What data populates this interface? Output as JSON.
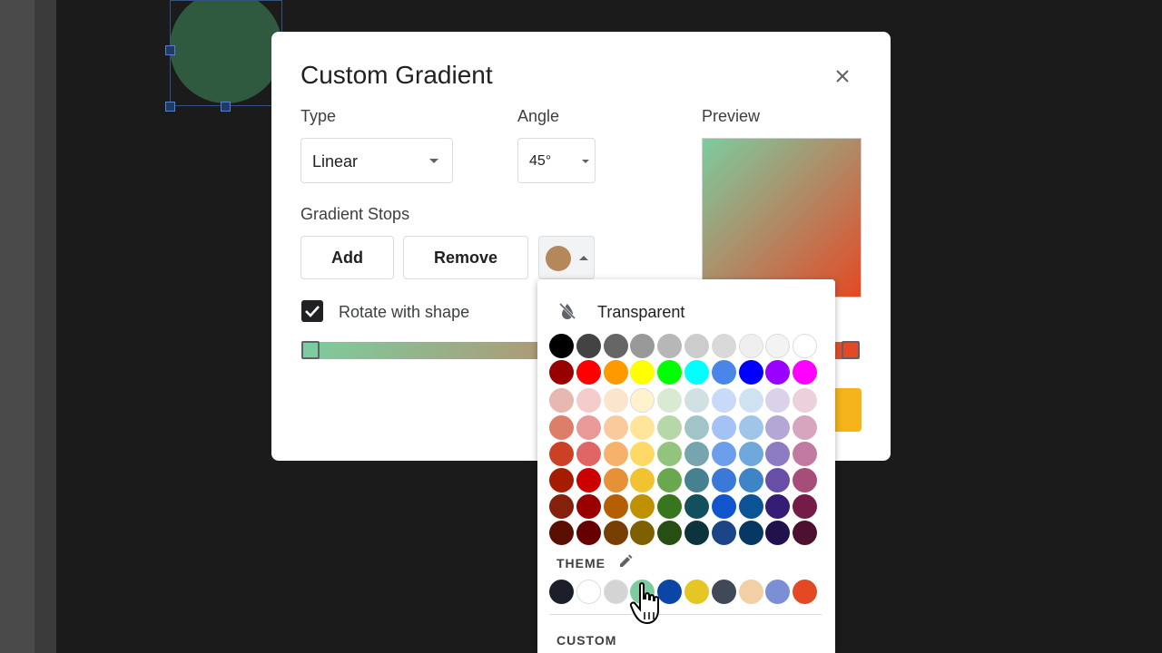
{
  "dialog": {
    "title": "Custom Gradient",
    "type_label": "Type",
    "type_value": "Linear",
    "angle_label": "Angle",
    "angle_value": "45°",
    "preview_label": "Preview",
    "stops_label": "Gradient Stops",
    "add_label": "Add",
    "remove_label": "Remove",
    "rotate_label": "Rotate with shape",
    "rotate_checked": true,
    "selected_stop_color": "#b5885c",
    "gradient_start": "#7ccc9f",
    "gradient_end": "#e34a24",
    "ok_color": "#f4b41a"
  },
  "palette": {
    "transparent_label": "Transparent",
    "standard_colors": [
      [
        "#000000",
        "#434343",
        "#666666",
        "#999999",
        "#b7b7b7",
        "#cccccc",
        "#d9d9d9",
        "#efefef",
        "#f3f3f3",
        "#ffffff"
      ],
      [
        "#980000",
        "#ff0000",
        "#ff9900",
        "#ffff00",
        "#00ff00",
        "#00ffff",
        "#4a86e8",
        "#0000ff",
        "#9900ff",
        "#ff00ff"
      ],
      [
        "#e6b8af",
        "#f4cccc",
        "#fce5cd",
        "#fff2cc",
        "#d9ead3",
        "#d0e0e3",
        "#c9daf8",
        "#cfe2f3",
        "#d9d2e9",
        "#ead1dc"
      ],
      [
        "#dd7e6b",
        "#ea9999",
        "#f9cb9c",
        "#ffe599",
        "#b6d7a8",
        "#a2c4c9",
        "#a4c2f4",
        "#9fc5e8",
        "#b4a7d6",
        "#d5a6bd"
      ],
      [
        "#cc4125",
        "#e06666",
        "#f6b26b",
        "#ffd966",
        "#93c47d",
        "#76a5af",
        "#6d9eeb",
        "#6fa8dc",
        "#8e7cc3",
        "#c27ba0"
      ],
      [
        "#a61c00",
        "#cc0000",
        "#e69138",
        "#f1c232",
        "#6aa84f",
        "#45818e",
        "#3c78d8",
        "#3d85c6",
        "#674ea7",
        "#a64d79"
      ],
      [
        "#85200c",
        "#990000",
        "#b45f06",
        "#bf9000",
        "#38761d",
        "#134f5c",
        "#1155cc",
        "#0b5394",
        "#351c75",
        "#741b47"
      ],
      [
        "#5b0f00",
        "#660000",
        "#783f04",
        "#7f6000",
        "#274e13",
        "#0c343d",
        "#1c4587",
        "#073763",
        "#20124d",
        "#4c1130"
      ]
    ],
    "theme_label": "THEME",
    "theme_colors": [
      "#1b1f2a",
      "#ffffff",
      "#d4d4d4",
      "#7ccc9f",
      "#0b46a6",
      "#e5c624",
      "#414959",
      "#f0d0a4",
      "#7b8fd6",
      "#e34a24"
    ],
    "custom_label": "CUSTOM"
  }
}
